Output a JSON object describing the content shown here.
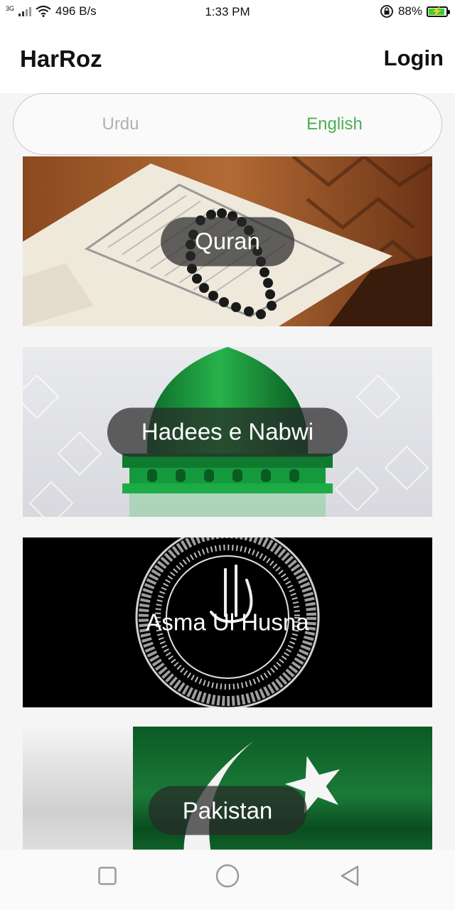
{
  "status_bar": {
    "network_type": "3G",
    "speed": "496 B/s",
    "time": "1:33 PM",
    "battery": "88%",
    "icons": [
      "signal-icon",
      "wifi-icon",
      "rotation-lock-icon",
      "battery-charging-icon"
    ]
  },
  "app_bar": {
    "title": "HarRoz",
    "login_label": "Login"
  },
  "language_toggle": {
    "options": [
      {
        "label": "Urdu",
        "selected": false
      },
      {
        "label": "English",
        "selected": true
      }
    ],
    "selected_color": "#4caf50",
    "unselected_color": "#b0b0b0"
  },
  "cards": [
    {
      "label": "Quran",
      "image": "open-quran-with-prayer-beads"
    },
    {
      "label": "Hadees e Nabwi",
      "image": "green-dome"
    },
    {
      "label": "Asma Ul Husna",
      "image": "calligraphy-circle"
    },
    {
      "label": "Pakistan",
      "image": "pakistan-flag"
    }
  ],
  "nav_bar": {
    "icons": [
      "recents-square-icon",
      "home-circle-icon",
      "back-triangle-icon"
    ]
  }
}
